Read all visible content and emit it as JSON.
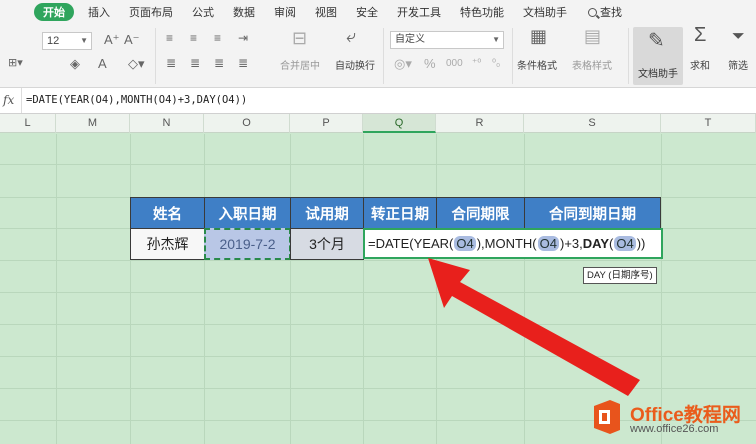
{
  "menubar": {
    "tabs": [
      "开始",
      "插入",
      "页面布局",
      "公式",
      "数据",
      "审阅",
      "视图",
      "安全",
      "开发工具",
      "特色功能",
      "文档助手"
    ],
    "active_tab": "开始",
    "search_label": "查找"
  },
  "ribbon": {
    "font_size": "12",
    "number_format": "自定义",
    "merge_center": "合并居中",
    "wrap_text": "自动换行",
    "conditional_format": "条件格式",
    "table_style": "表格样式",
    "doc_assistant": "文档助手",
    "sum_label": "求和",
    "filter_label": "筛选"
  },
  "formula_bar": {
    "fx": "fx",
    "formula": "=DATE(YEAR(O4),MONTH(O4)+3,DAY(O4))"
  },
  "columns": [
    "L",
    "M",
    "N",
    "O",
    "P",
    "Q",
    "R",
    "S",
    "T"
  ],
  "active_column": "Q",
  "table": {
    "headers": [
      "姓名",
      "入职日期",
      "试用期",
      "转正日期",
      "合同期限",
      "合同到期日期"
    ],
    "row": {
      "name": "孙杰辉",
      "hire_date": "2019-7-2",
      "probation": "3个月"
    }
  },
  "edit_cell": {
    "p1": "=DATE(YEAR(",
    "r1": "O4",
    "p2": "),MONTH(",
    "r2": "O4",
    "p3": ")+3,",
    "fn": "DAY",
    "p4": "(",
    "r3": "O4",
    "p5": "))"
  },
  "tooltip": "DAY (日期序号)",
  "watermark": {
    "title": "Office教程网",
    "url": "www.office26.com"
  },
  "colors": {
    "grid_bg": "#cce8cf",
    "header_blue": "#3f7fc6",
    "accent_green": "#2fa55d",
    "arrow_red": "#e8201c"
  }
}
